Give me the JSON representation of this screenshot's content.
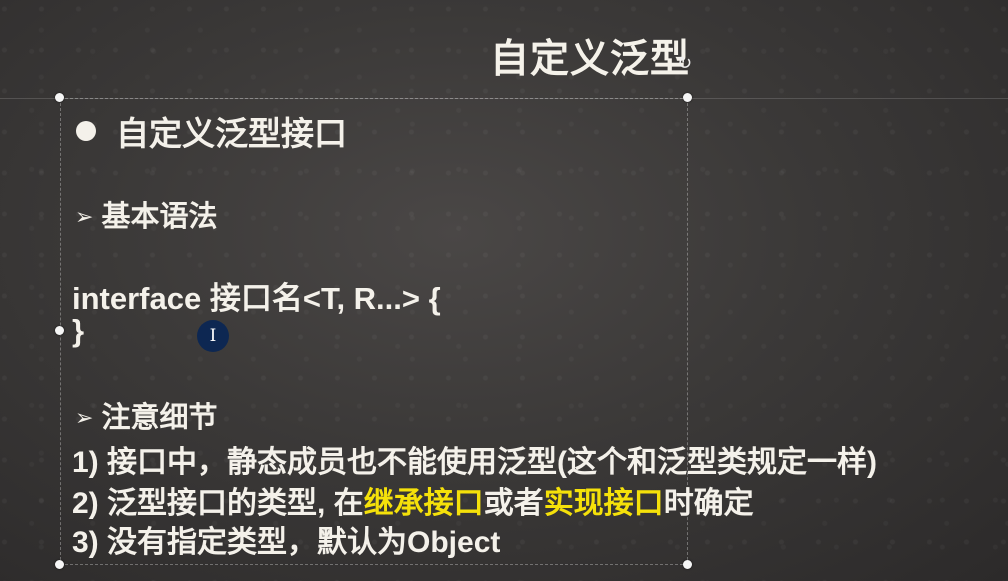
{
  "slide": {
    "title": "自定义泛型",
    "heading": "自定义泛型接口",
    "syntax_heading": "基本语法",
    "code_line1": "interface 接口名<T, R...> {",
    "code_line2": "}",
    "notes_heading": "注意细节",
    "note1": "1) 接口中，静态成员也不能使用泛型(这个和泛型类规定一样)",
    "note2": {
      "prefix": "2) 泛型接口的类型, 在",
      "highlight1": "继承接口",
      "middle": "或者",
      "highlight2": "实现接口",
      "suffix": "时确定"
    },
    "note3": "3) 没有指定类型，默认为Object"
  },
  "icons": {
    "bullet": "filled-circle",
    "sub_bullet": "arrow-right-icon",
    "cursor": "text-cursor-icon",
    "rotate": "rotate-handle-icon"
  },
  "colors": {
    "background": "#3b3938",
    "text": "#f4f1ea",
    "highlight": "#f5e10a",
    "cursor_badge": "#0d2752"
  }
}
